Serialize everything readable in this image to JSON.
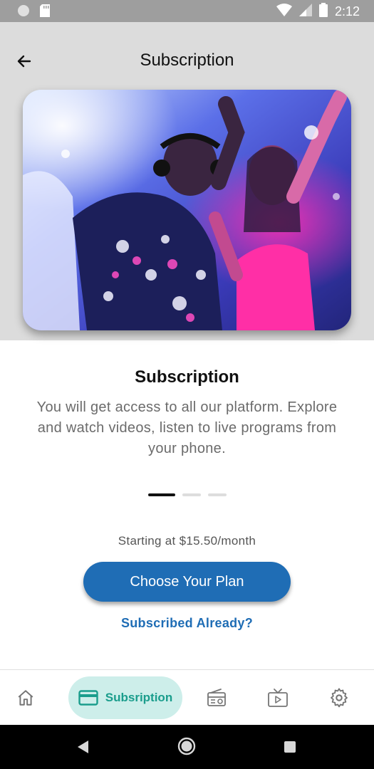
{
  "status_bar": {
    "time": "2:12"
  },
  "app_bar": {
    "title": "Subscription"
  },
  "content": {
    "title": "Subscription",
    "description": "You will get access to all our platform. Explore and watch videos, listen to live programs from your phone.",
    "price_text": "Starting at $15.50/month",
    "choose_plan_label": "Choose Your Plan",
    "subscribed_already_label": "Subscribed Already?"
  },
  "pager": {
    "count": 3,
    "active_index": 0
  },
  "bottom_nav": {
    "items": [
      {
        "icon": "home-icon"
      },
      {
        "icon": "credit-card-icon",
        "label": "Subsription"
      },
      {
        "icon": "radio-icon"
      },
      {
        "icon": "tv-icon"
      },
      {
        "icon": "gear-icon"
      }
    ],
    "active_index": 1
  },
  "colors": {
    "primary": "#1f6db5",
    "accent_teal": "#1a9d8c",
    "pill_bg": "#cdeeea",
    "header_bg": "#dcdcdc"
  }
}
